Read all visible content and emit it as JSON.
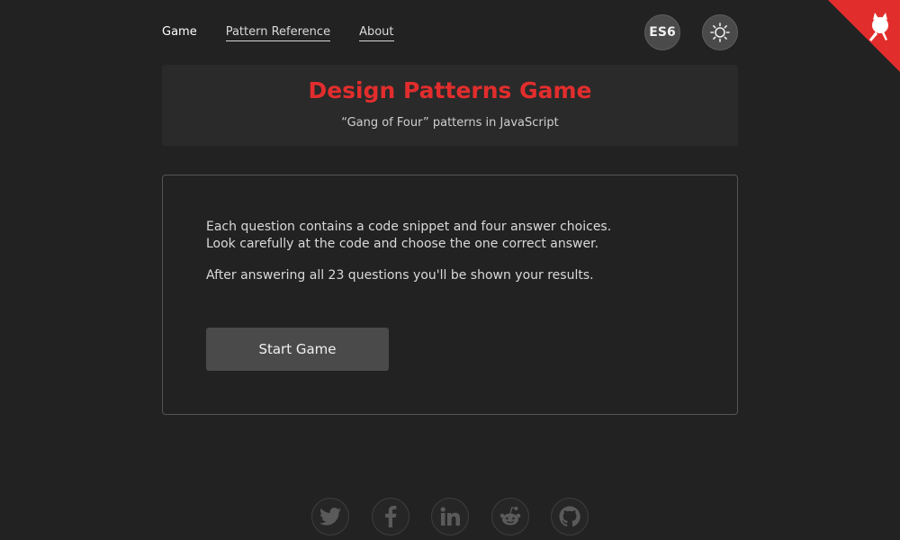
{
  "nav": {
    "items": [
      {
        "label": "Game",
        "active": true
      },
      {
        "label": "Pattern Reference",
        "active": false
      },
      {
        "label": "About",
        "active": false
      }
    ],
    "es_toggle_label": "ES6",
    "theme_icon": "sun-icon"
  },
  "header": {
    "title": "Design Patterns Game",
    "subtitle": "“Gang of Four” patterns in JavaScript"
  },
  "intro": {
    "line1": "Each question contains a code snippet and four answer choices.",
    "line2": "Look carefully at the code and choose the one correct answer.",
    "line3": "After answering all 23 questions you'll be shown your results."
  },
  "start_button_label": "Start Game",
  "social": [
    "twitter-icon",
    "facebook-icon",
    "linkedin-icon",
    "reddit-icon",
    "github-icon"
  ],
  "colors": {
    "background": "#222222",
    "accent": "#e22d2d",
    "button": "#4a4a4a"
  }
}
